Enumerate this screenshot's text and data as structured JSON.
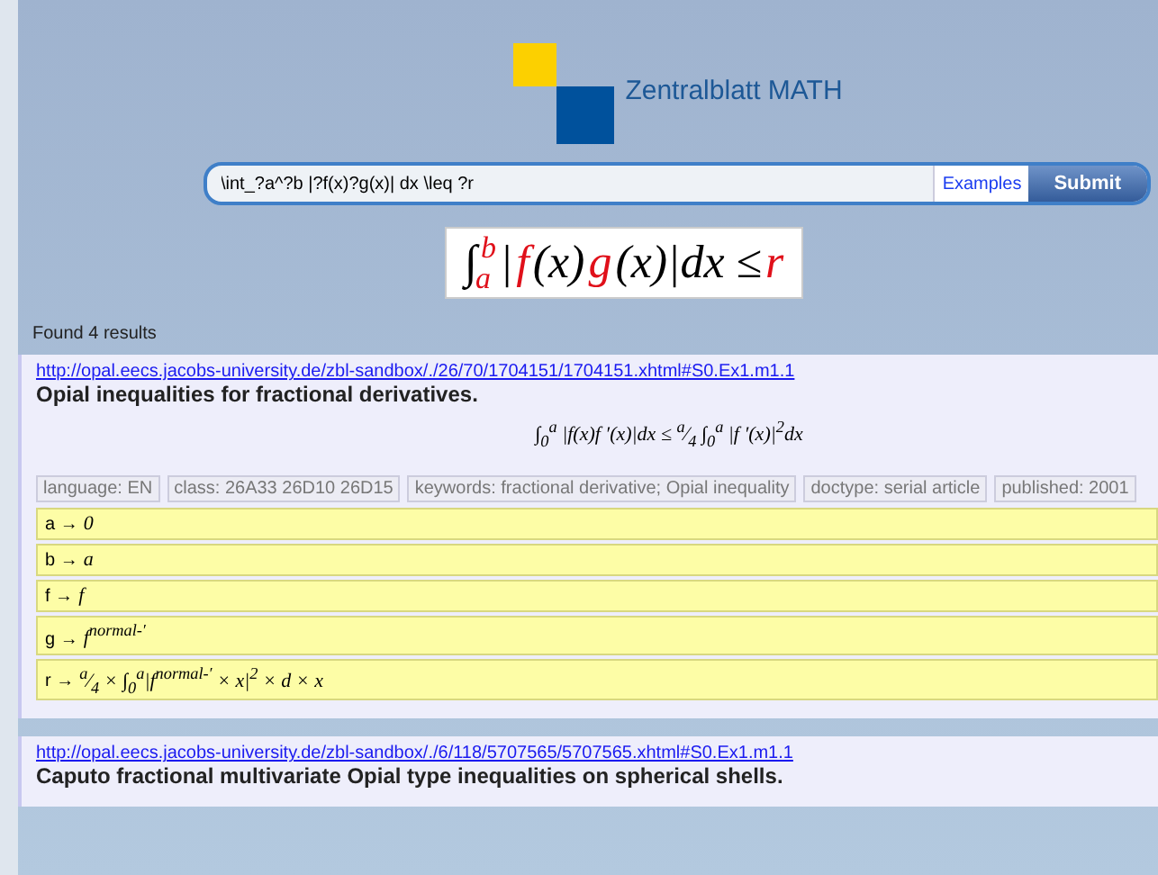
{
  "logo": {
    "title": "Zentralblatt MATH"
  },
  "search": {
    "value": "\\int_?a^?b |?f(x)?g(x)| dx \\leq ?r",
    "examples_link": "Examples",
    "submit_button": "Submit"
  },
  "query_formula": [
    {
      "kind": "symbol",
      "text": "∫",
      "highlighted": false
    },
    {
      "kind": "limits",
      "upper": "b",
      "lower": "a",
      "highlighted": true
    },
    {
      "kind": "symbol",
      "text": "|",
      "highlighted": false
    },
    {
      "kind": "symbol",
      "text": "f",
      "highlighted": true
    },
    {
      "kind": "symbol",
      "text": "(x)",
      "highlighted": false
    },
    {
      "kind": "symbol",
      "text": "g",
      "highlighted": true
    },
    {
      "kind": "symbol",
      "text": "(x)|dx ≤",
      "highlighted": false
    },
    {
      "kind": "symbol",
      "text": "r",
      "highlighted": true
    }
  ],
  "results_count": "Found 4 results",
  "results": [
    {
      "url": "http://opal.eecs.jacobs-university.de/zbl-sandbox/./26/70/1704151/1704151.xhtml#S0.Ex1.m1.1",
      "title": "Opial inequalities for fractional derivatives.",
      "formula": "∫$_{0}$$^{a}$ |f(x)f ′(x)|dx ≤ $^{a}$⁄$_{4}$ ∫$_{0}$$^{a}$ |f ′(x)|$^{2}$dx",
      "tags": [
        "language: EN",
        "class: 26A33 26D10 26D15",
        "keywords: fractional derivative; Opial inequality",
        "doctype: serial article",
        "published: 2001"
      ],
      "substitutions": [
        {
          "label": "a →",
          "value": "0"
        },
        {
          "label": "b →",
          "value": "a"
        },
        {
          "label": "f →",
          "value": "f"
        },
        {
          "label": "g →",
          "value": "f$^{normal-′}$"
        },
        {
          "label": "r →",
          "value": "$^{a}$⁄$_{4}$ × ∫$_{0}$$^{a}$|f$^{normal-′}$ × x|$^{2}$ × d × x"
        }
      ]
    },
    {
      "url": "http://opal.eecs.jacobs-university.de/zbl-sandbox/./6/118/5707565/5707565.xhtml#S0.Ex1.m1.1",
      "title": "Caputo fractional multivariate Opial type inequalities on spherical shells."
    }
  ]
}
